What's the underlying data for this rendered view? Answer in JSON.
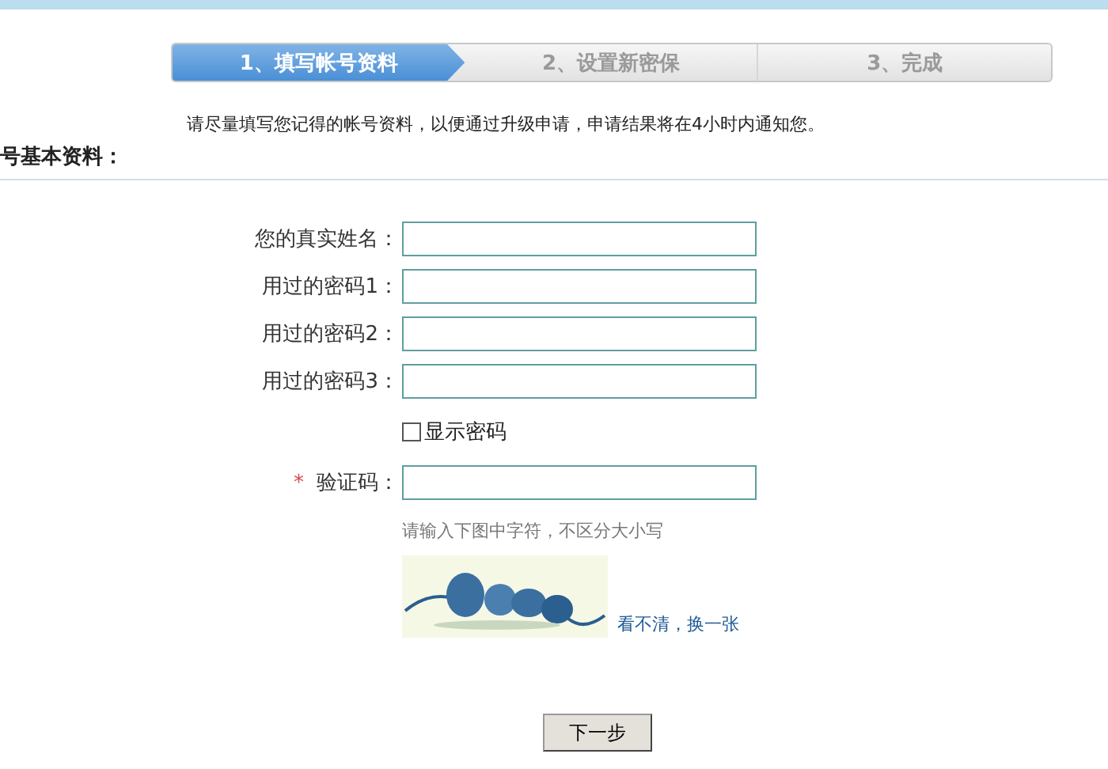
{
  "steps": [
    {
      "label": "1、填写帐号资料",
      "selected": true
    },
    {
      "label": "2、设置新密保",
      "selected": false
    },
    {
      "label": "3、完成",
      "selected": false
    }
  ],
  "notice": "请尽量填写您记得的帐号资料，以便通过升级申请，申请结果将在4小时内通知您。",
  "section_title": "号基本资料：",
  "fields": [
    {
      "label": "您的真实姓名：",
      "required": false
    },
    {
      "label": "用过的密码1：",
      "required": false
    },
    {
      "label": "用过的密码2：",
      "required": false
    },
    {
      "label": "用过的密码3：",
      "required": false
    }
  ],
  "show_password": {
    "label": "显示密码",
    "checked": false
  },
  "captcha": {
    "label": "验证码：",
    "required": true,
    "required_mark": "*",
    "hint": "请输入下图中字符，不区分大小写",
    "refresh_link": "看不清，换一张"
  },
  "next_button": "下一步"
}
